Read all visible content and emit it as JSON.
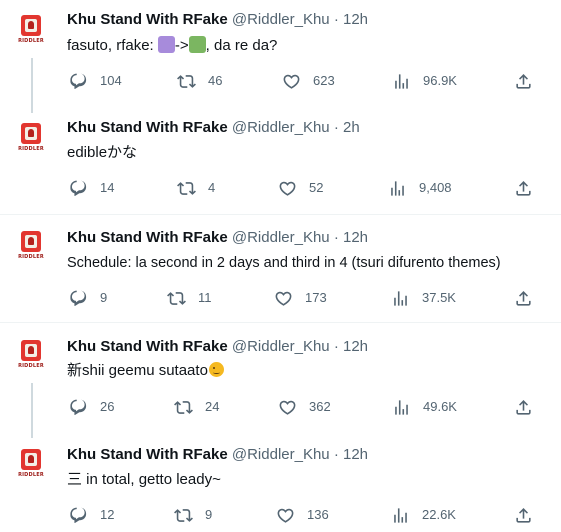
{
  "tweets": [
    {
      "name": "Khu Stand With RFake",
      "handle": "@Riddler_Khu",
      "dot": "·",
      "time": "12h",
      "avatar_text": "RIDDLER",
      "text_before": "fasuto, rfake: ",
      "arrow": "->",
      "text_after": ", da re da?",
      "swatch_colors": [
        "#a78bdb",
        "#7bb661"
      ],
      "replies": "104",
      "retweets": "46",
      "likes": "623",
      "views": "96.9K"
    },
    {
      "name": "Khu Stand With RFake",
      "handle": "@Riddler_Khu",
      "dot": "·",
      "time": "2h",
      "avatar_text": "RIDDLER",
      "text": "edibleかな",
      "replies": "14",
      "retweets": "4",
      "likes": "52",
      "views": "9,408"
    },
    {
      "name": "Khu Stand With RFake",
      "handle": "@Riddler_Khu",
      "dot": "·",
      "time": "12h",
      "avatar_text": "RIDDLER",
      "text": "Schedule: la second in 2 days and third in 4 (tsuri difurento themes)",
      "replies": "9",
      "retweets": "11",
      "likes": "173",
      "views": "37.5K"
    },
    {
      "name": "Khu Stand With RFake",
      "handle": "@Riddler_Khu",
      "dot": "·",
      "time": "12h",
      "avatar_text": "RIDDLER",
      "text": "新shii geemu sutaato",
      "emoji": "winking-face",
      "replies": "26",
      "retweets": "24",
      "likes": "362",
      "views": "49.6K"
    },
    {
      "name": "Khu Stand With RFake",
      "handle": "@Riddler_Khu",
      "dot": "·",
      "time": "12h",
      "avatar_text": "RIDDLER",
      "text": "三 in total, getto leady~",
      "replies": "12",
      "retweets": "9",
      "likes": "136",
      "views": "22.6K"
    }
  ],
  "icons": {
    "reply": "reply-icon",
    "retweet": "retweet-icon",
    "like": "heart-icon",
    "views": "views-icon",
    "share": "share-icon"
  },
  "colors": {
    "text": "#0f1419",
    "secondary": "#536471",
    "thread_line": "#cfd9de",
    "brand_red": "#e2362f"
  }
}
